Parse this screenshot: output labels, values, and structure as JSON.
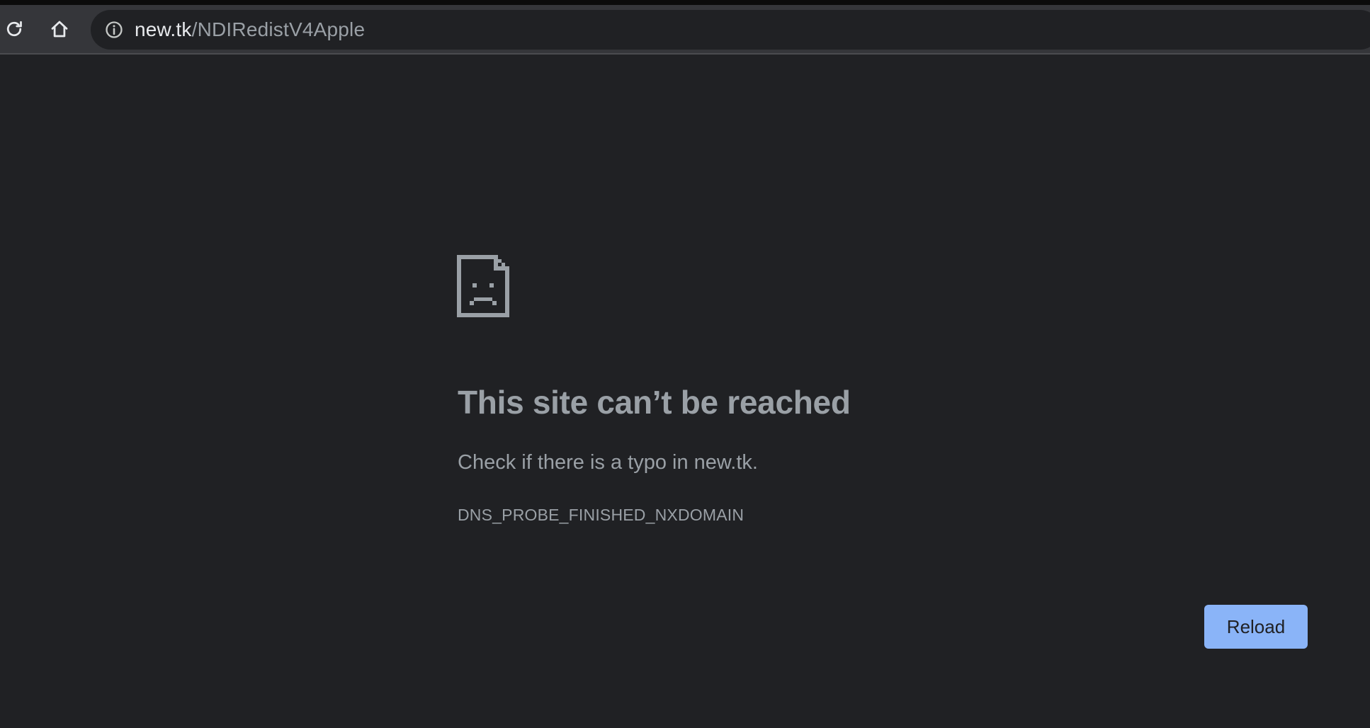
{
  "toolbar": {
    "reload_icon": "reload-icon",
    "home_icon": "home-icon",
    "site_info_icon": "info-icon",
    "url_host": "new.tk",
    "url_path": "/NDIRedistV4Apple"
  },
  "error_page": {
    "icon": "sad-document-icon",
    "headline": "This site can’t be reached",
    "suggestion": "Check if there is a typo in new.tk.",
    "error_code": "DNS_PROBE_FINISHED_NXDOMAIN",
    "reload_label": "Reload"
  },
  "colors": {
    "page_background": "#202124",
    "toolbar_background": "#35363a",
    "text_secondary": "#9aa0a6",
    "button_accent": "#8ab4f8"
  }
}
